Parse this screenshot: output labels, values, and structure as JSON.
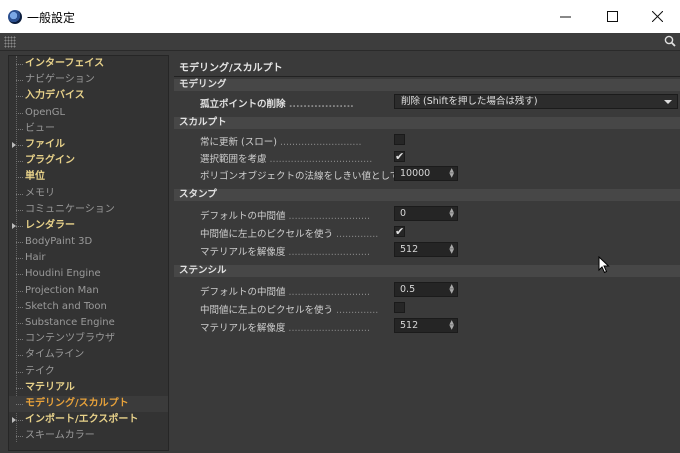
{
  "window": {
    "title": "一般設定"
  },
  "sidebar": {
    "items": [
      {
        "label": "インターフェイス",
        "bold": true,
        "arrow": false
      },
      {
        "label": "ナビゲーション",
        "bold": false,
        "arrow": false
      },
      {
        "label": "入力デバイス",
        "bold": true,
        "arrow": false
      },
      {
        "label": "OpenGL",
        "bold": false,
        "arrow": false
      },
      {
        "label": "ビュー",
        "bold": false,
        "arrow": false
      },
      {
        "label": "ファイル",
        "bold": true,
        "arrow": true
      },
      {
        "label": "プラグイン",
        "bold": true,
        "arrow": false
      },
      {
        "label": "単位",
        "bold": true,
        "arrow": false
      },
      {
        "label": "メモリ",
        "bold": false,
        "arrow": false
      },
      {
        "label": "コミュニケーション",
        "bold": false,
        "arrow": false
      },
      {
        "label": "レンダラー",
        "bold": true,
        "arrow": true
      },
      {
        "label": "BodyPaint 3D",
        "bold": false,
        "arrow": false
      },
      {
        "label": "Hair",
        "bold": false,
        "arrow": false
      },
      {
        "label": "Houdini Engine",
        "bold": false,
        "arrow": false
      },
      {
        "label": "Projection Man",
        "bold": false,
        "arrow": false
      },
      {
        "label": "Sketch and Toon",
        "bold": false,
        "arrow": false
      },
      {
        "label": "Substance Engine",
        "bold": false,
        "arrow": false
      },
      {
        "label": "コンテンツブラウザ",
        "bold": false,
        "arrow": false
      },
      {
        "label": "タイムライン",
        "bold": false,
        "arrow": false
      },
      {
        "label": "テイク",
        "bold": false,
        "arrow": false
      },
      {
        "label": "マテリアル",
        "bold": true,
        "arrow": false
      },
      {
        "label": "モデリング/スカルプト",
        "bold": true,
        "arrow": false,
        "active": true
      },
      {
        "label": "インポート/エクスポート",
        "bold": true,
        "arrow": true
      },
      {
        "label": "スキームカラー",
        "bold": false,
        "arrow": false
      }
    ]
  },
  "panel": {
    "title": "モデリング/スカルプト",
    "modeling": {
      "header": "モデリング",
      "isolated_points": {
        "label": "孤立ポイントの削除",
        "value": "削除 (Shiftを押した場合は残す)"
      }
    },
    "sculpt": {
      "header": "スカルプト",
      "always_update": {
        "label": "常に更新 (スロー)",
        "checked": ""
      },
      "consider_selection": {
        "label": "選択範囲を考慮",
        "checked": "✔"
      },
      "polygon_threshold": {
        "label": "ポリゴンオブジェクトの法線をしきい値として使う",
        "value": "10000"
      }
    },
    "stamp": {
      "header": "スタンプ",
      "default_mid": {
        "label": "デフォルトの中間値",
        "value": "0"
      },
      "top_left_pixel": {
        "label": "中間値に左上のピクセルを使う",
        "checked": "✔"
      },
      "material_res": {
        "label": "マテリアルを解像度",
        "value": "512"
      }
    },
    "stencil": {
      "header": "ステンシル",
      "default_mid": {
        "label": "デフォルトの中間値",
        "value": "0.5"
      },
      "top_left_pixel": {
        "label": "中間値に左上のピクセルを使う",
        "checked": ""
      },
      "material_res": {
        "label": "マテリアルを解像度",
        "value": "512"
      }
    }
  },
  "colors": {
    "accent": "#e8a23a",
    "bold_label": "#e8d28a",
    "background": "#3a3a3a"
  },
  "icons": {
    "app": "cinema4d-icon",
    "search": "search-icon"
  }
}
